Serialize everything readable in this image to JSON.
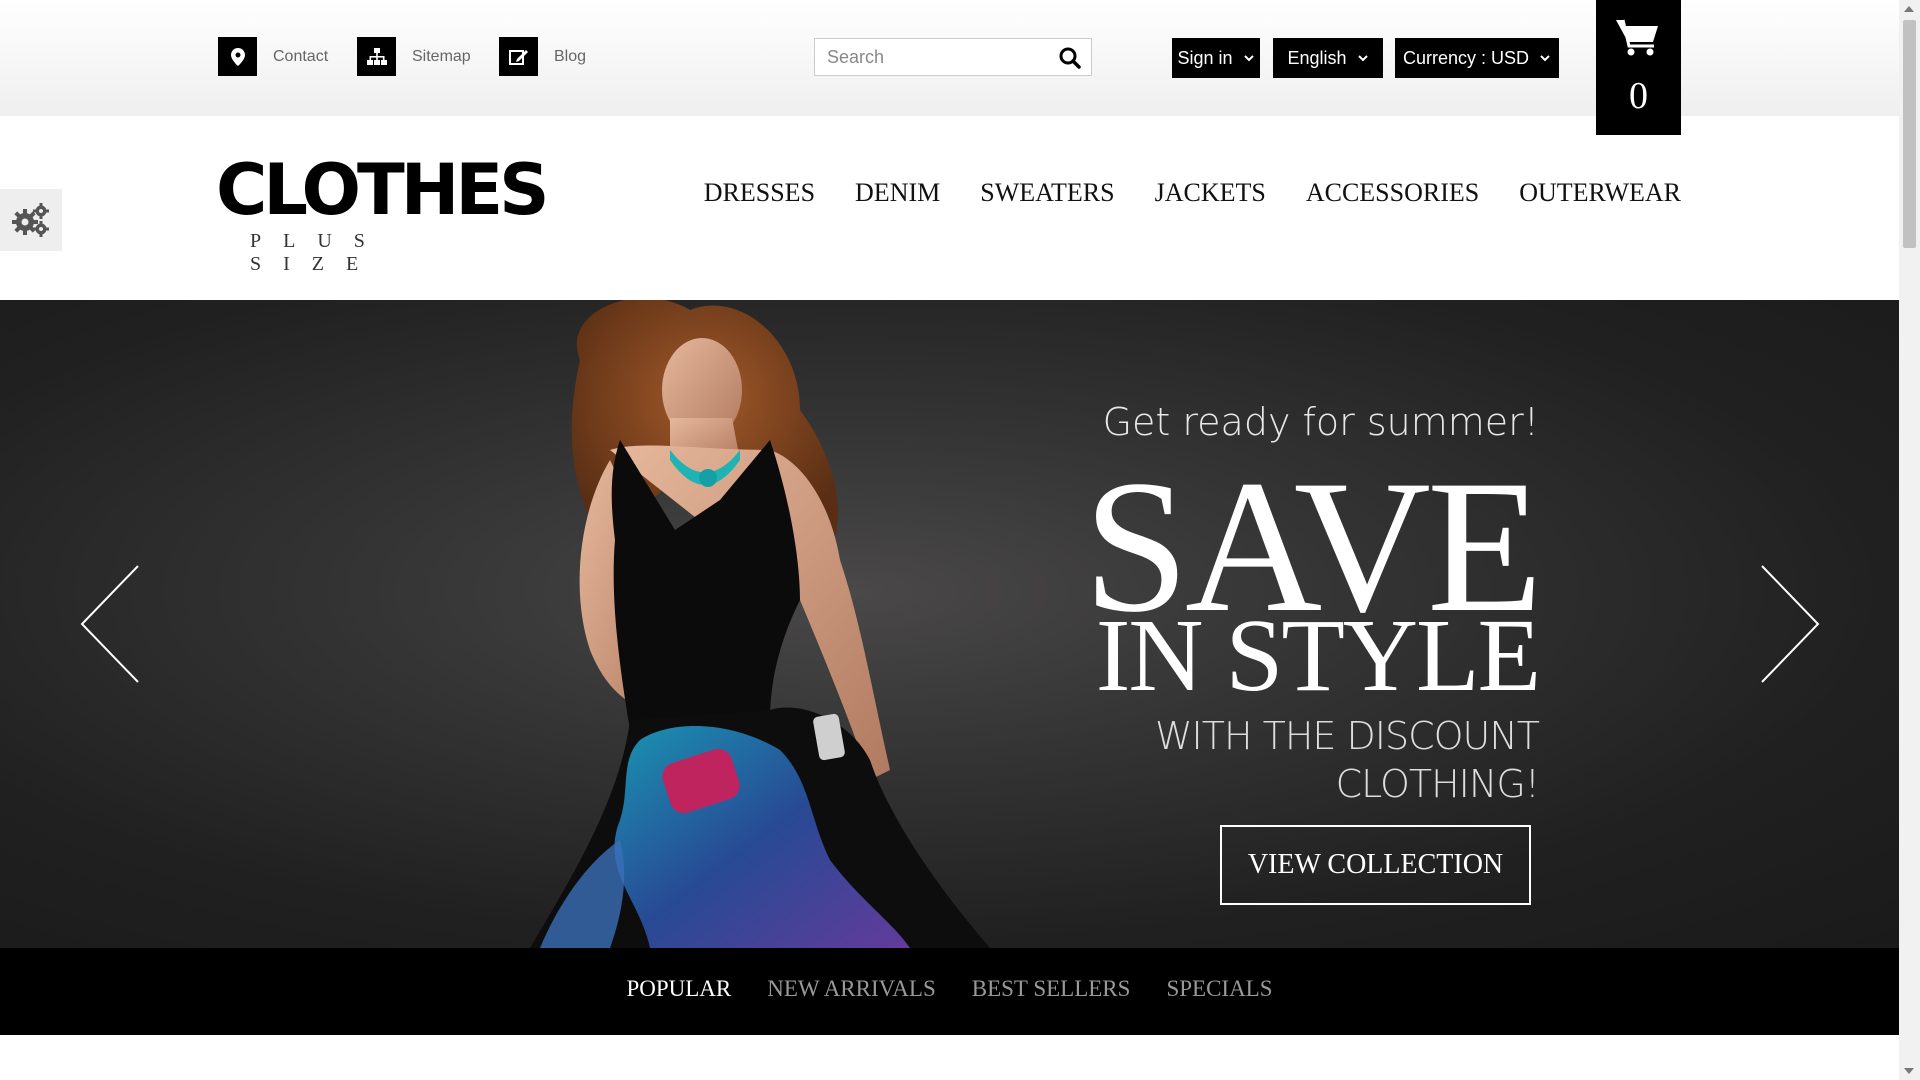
{
  "topbar": {
    "links": [
      {
        "label": "Contact",
        "icon": "map-marker-icon"
      },
      {
        "label": "Sitemap",
        "icon": "sitemap-icon"
      },
      {
        "label": "Blog",
        "icon": "edit-icon"
      }
    ],
    "search": {
      "placeholder": "Search"
    },
    "signin_label": "Sign in",
    "language_label": "English",
    "currency_label": "Currency : USD",
    "cart_count": "0"
  },
  "header": {
    "logo_main": "CLOTHES",
    "logo_sub": "PLUS SIZE",
    "nav": [
      "DRESSES",
      "DENIM",
      "SWEATERS",
      "JACKETS",
      "ACCESSORIES",
      "OUTERWEAR"
    ]
  },
  "hero": {
    "tagline": "Get ready for summer!",
    "headline": "SAVE",
    "headline2": "IN STYLE",
    "subline1": "WITH THE DISCOUNT",
    "subline2": "CLOTHING!",
    "cta": "VIEW COLLECTION"
  },
  "tabs": {
    "items": [
      "POPULAR",
      "NEW ARRIVALS",
      "BEST SELLERS",
      "SPECIALS"
    ],
    "active": "POPULAR"
  },
  "colors": {
    "primary": "#000000",
    "tab_active": "#ffffff",
    "tab_inactive": "#999999"
  }
}
